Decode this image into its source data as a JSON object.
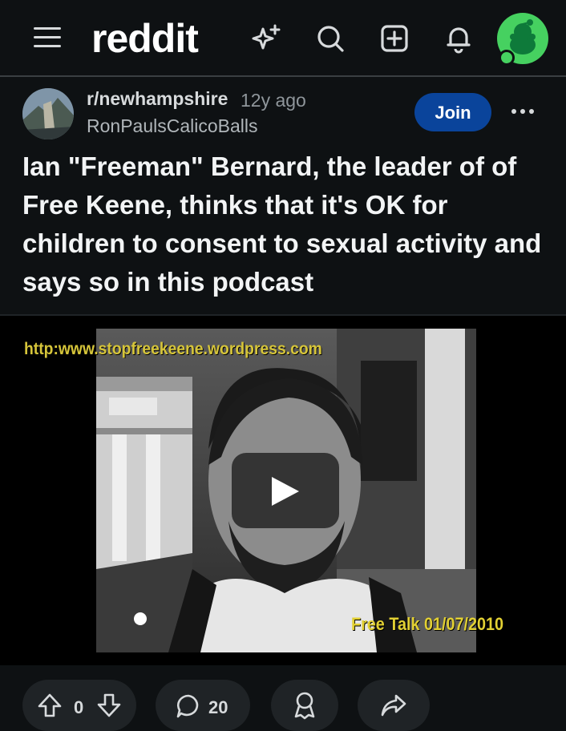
{
  "header": {
    "logo_text": "reddit",
    "icons": [
      "menu-icon",
      "sparkle-icon",
      "search-icon",
      "create-post-icon",
      "notifications-icon",
      "user-avatar"
    ]
  },
  "post": {
    "subreddit": "r/newhampshire",
    "age": "12y ago",
    "author": "RonPaulsCalicoBalls",
    "join_label": "Join",
    "title": "Ian \"Freeman\" Bernard, the leader of of Free Keene, thinks that it's OK for children to consent to sexual activity and says so in this podcast",
    "video": {
      "overlay_url": "http:www.stopfreekeene.wordpress.com",
      "overlay_caption": "Free Talk 01/07/2010"
    }
  },
  "actions": {
    "vote_count": "0",
    "comment_count": "20"
  },
  "colors": {
    "background": "#0e1113",
    "join_button": "#0a449b",
    "avatar_green": "#46d160",
    "overlay_text": "#e2d033"
  }
}
